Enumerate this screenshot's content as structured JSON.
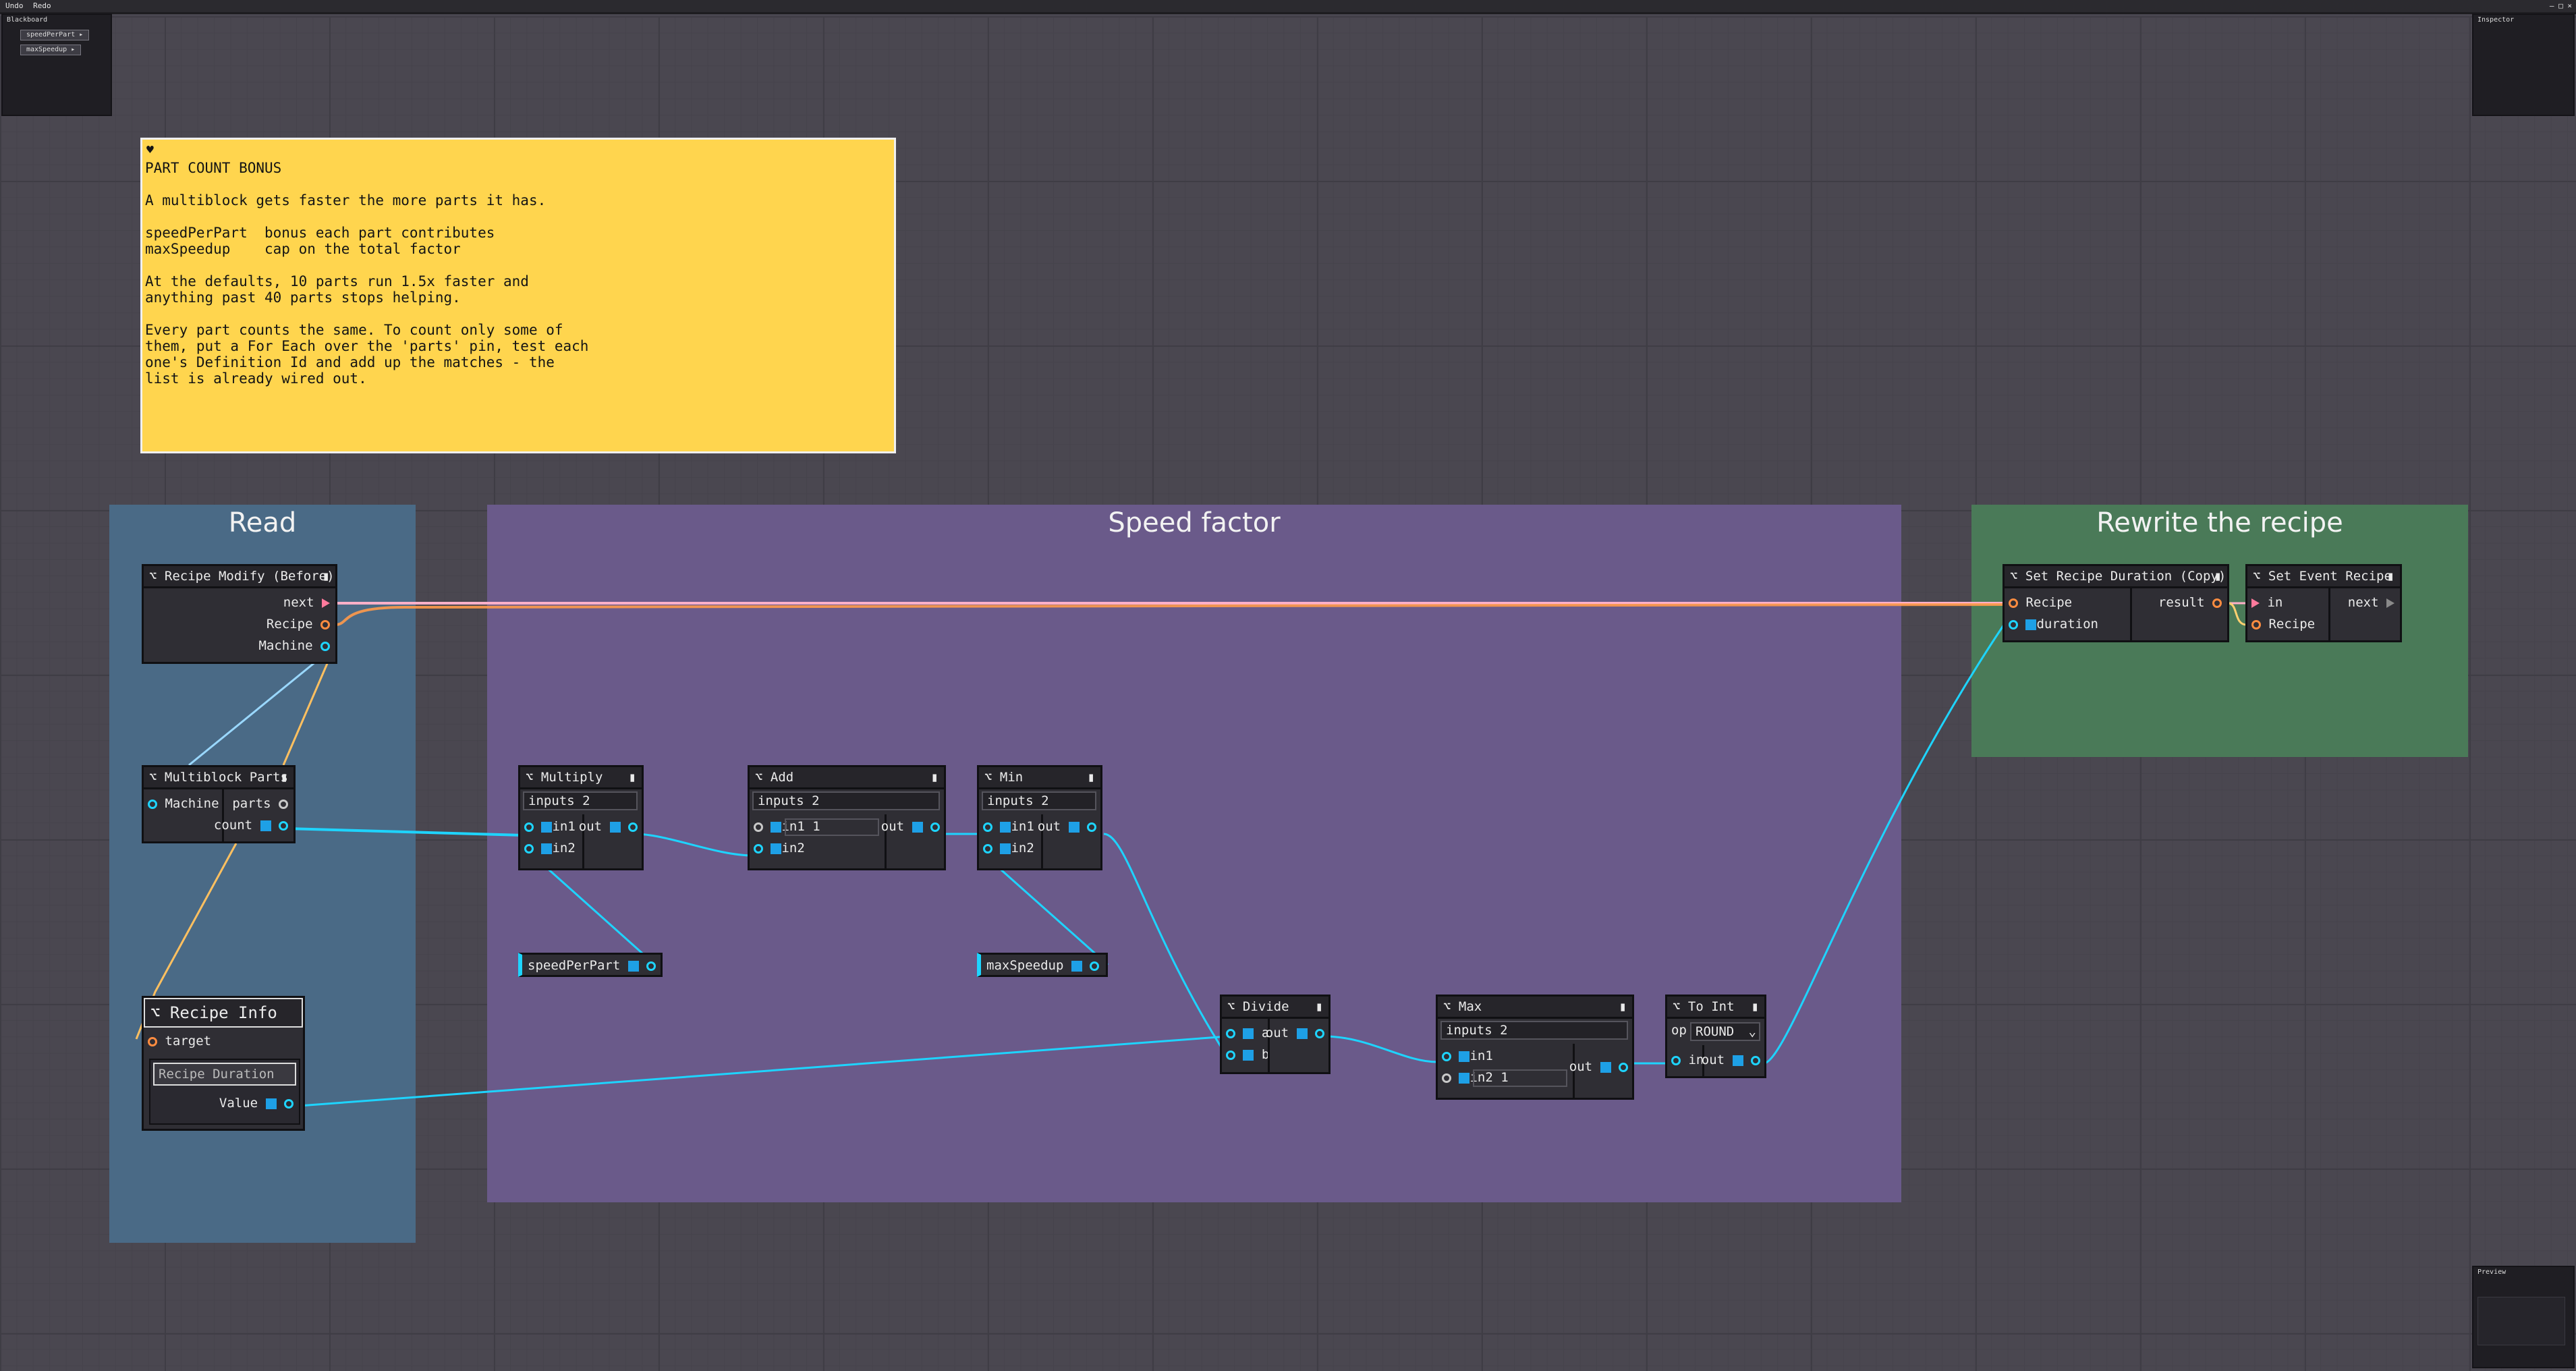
{
  "menubar": {
    "undo": "Undo",
    "redo": "Redo",
    "window_controls": "– □ ×"
  },
  "blackboard": {
    "title": "Blackboard",
    "items": [
      "speedPerPart ▸",
      "maxSpeedup ▸"
    ]
  },
  "inspector": {
    "title": "Inspector"
  },
  "preview": {
    "title": "Preview"
  },
  "note": {
    "title": "PART COUNT BONUS",
    "body": "A multiblock gets faster the more parts it has.\n\nspeedPerPart  bonus each part contributes\nmaxSpeedup    cap on the total factor\n\nAt the defaults, 10 parts run 1.5x faster and\nanything past 40 parts stops helping.\n\nEvery part counts the same. To count only some of\nthem, put a For Each over the 'parts' pin, test each\none's Definition Id and add up the matches - the\nlist is already wired out."
  },
  "groups": {
    "read": "Read",
    "speed": "Speed factor",
    "rewrite": "Rewrite the recipe"
  },
  "nodes": {
    "recipe_modify": {
      "title": "Recipe Modify (Before)",
      "next": "next",
      "recipe": "Recipe",
      "machine": "Machine"
    },
    "multiblock_parts": {
      "title": "Multiblock Parts",
      "machine": "Machine",
      "parts": "parts",
      "count": "count"
    },
    "recipe_info": {
      "title": "Recipe Info",
      "target": "target",
      "sub_title": "Recipe Duration",
      "value": "Value"
    },
    "multiply": {
      "title": "Multiply",
      "inputs": "inputs 2",
      "in1": "in1",
      "in2": "in2",
      "out": "out"
    },
    "add": {
      "title": "Add",
      "inputs": "inputs 2",
      "in1": "in1 1",
      "in2": "in2",
      "out": "out"
    },
    "min": {
      "title": "Min",
      "inputs": "inputs 2",
      "in1": "in1",
      "in2": "in2",
      "out": "out"
    },
    "speed_per_part": {
      "label": "speedPerPart"
    },
    "max_speedup": {
      "label": "maxSpeedup"
    },
    "divide": {
      "title": "Divide",
      "a": "a",
      "b": "b",
      "out": "out"
    },
    "max": {
      "title": "Max",
      "inputs": "inputs 2",
      "in1": "in1",
      "in2": "in2 1",
      "out": "out"
    },
    "to_int": {
      "title": "To Int",
      "op_label": "op",
      "op_value": "ROUND",
      "in": "in",
      "out": "out"
    },
    "set_duration": {
      "title": "Set Recipe Duration (Copy)",
      "recipe": "Recipe",
      "duration": "duration",
      "result": "result"
    },
    "set_event": {
      "title": "Set Event Recipe",
      "in": "in",
      "recipe": "Recipe",
      "next": "next"
    }
  },
  "colors": {
    "canvas": "#4a4750",
    "note": "#ffd54e",
    "read": "#4a6a86",
    "speed": "#6a5a8a",
    "rewrite": "#4a7a58",
    "wire_number": "#1ed4ff",
    "wire_recipe": "#ff9a4a",
    "wire_exec": "#ffb0c8",
    "wire_machine": "#9ad8ff"
  }
}
